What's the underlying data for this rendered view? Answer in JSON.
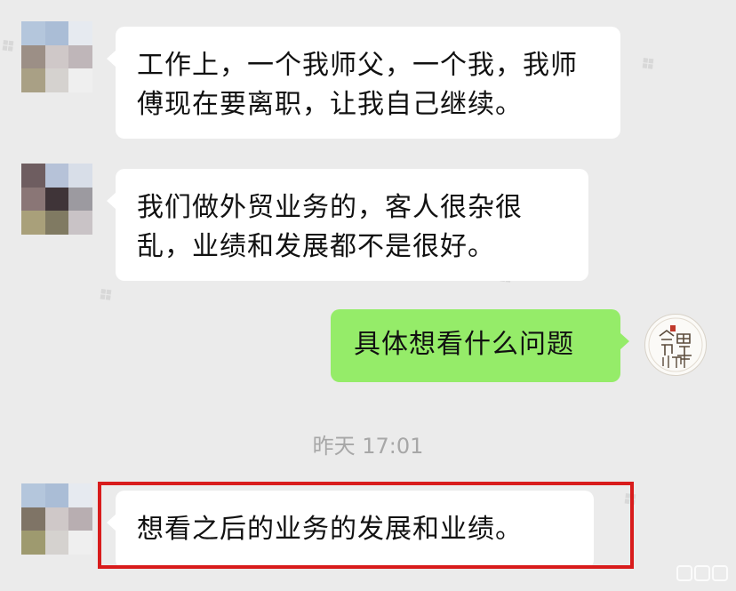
{
  "messages": [
    {
      "side": "left",
      "text": "工作上，一个我师父，一个我，我师傅现在要离职，让我自己继续。"
    },
    {
      "side": "left",
      "text": "我们做外贸业务的，客人很杂很乱，业绩和发展都不是很好。"
    },
    {
      "side": "right",
      "text": "具体想看什么问题"
    },
    {
      "side": "left",
      "text": "想看之后的业务的发展和业绩。"
    }
  ],
  "timestamp": "昨天 17:01",
  "self_avatar": {
    "icon": "seal-logo-icon",
    "text": "命理师"
  },
  "colors": {
    "background": "#ebebeb",
    "left_bubble": "#ffffff",
    "right_bubble": "#95ec69",
    "highlight_box": "#d81b1b"
  }
}
